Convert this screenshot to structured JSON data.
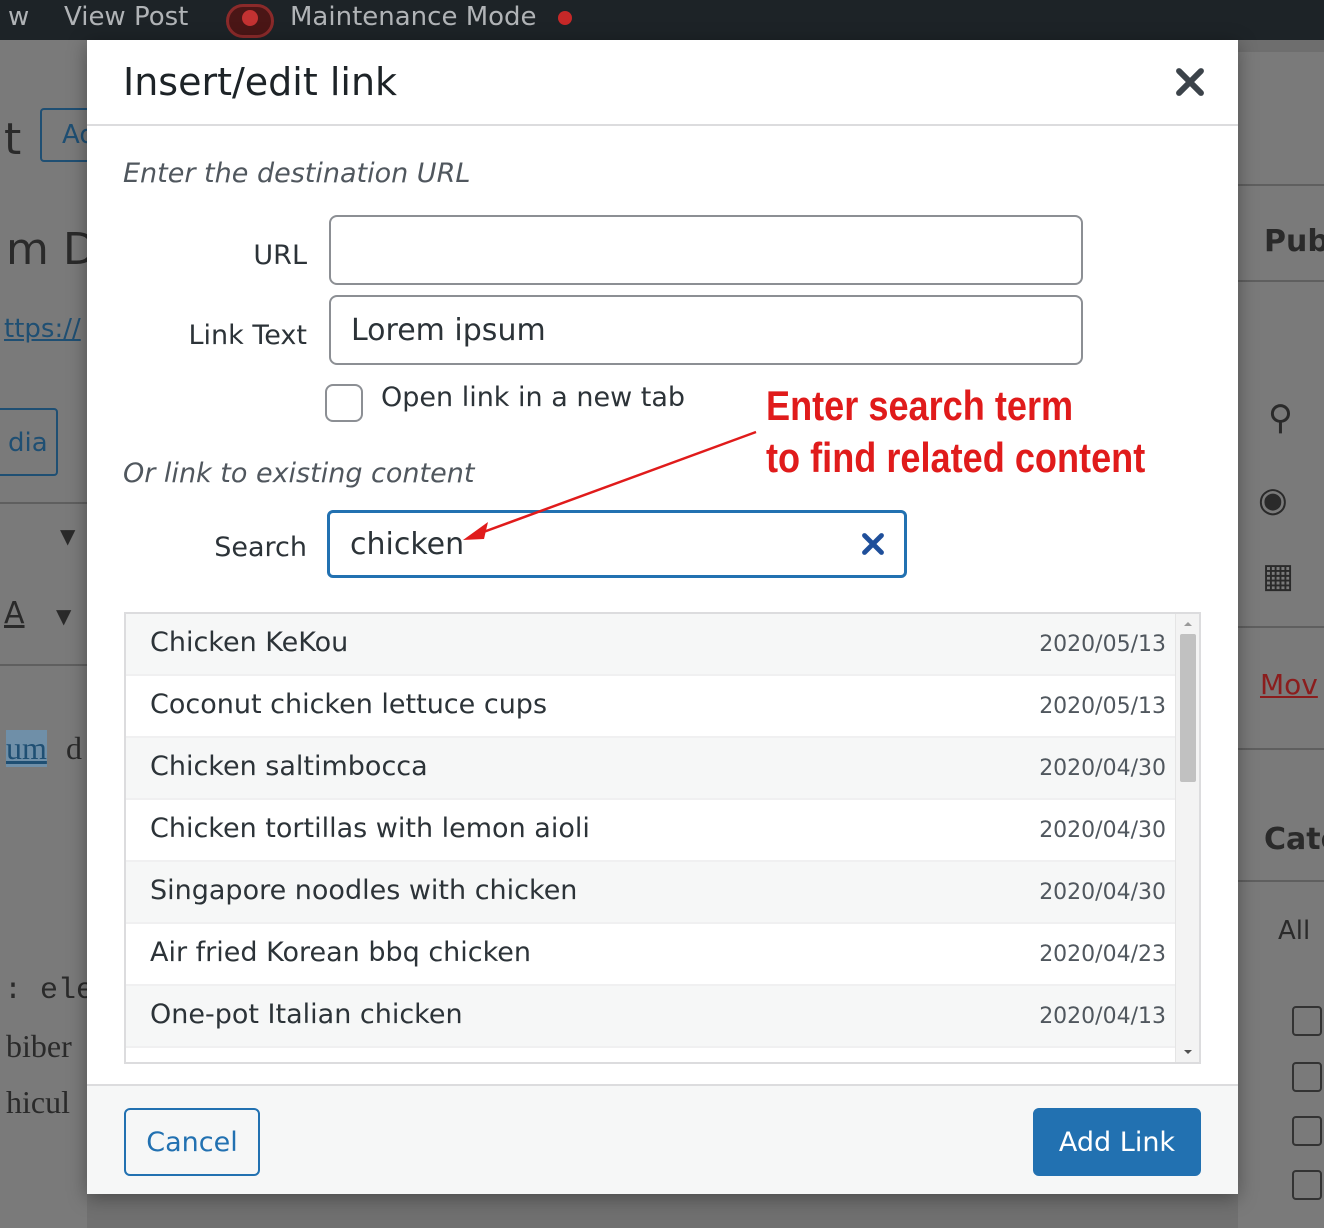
{
  "background": {
    "admin_bar": {
      "left_partial": "w",
      "view_post": "View Post",
      "maintenance_mode": "Maintenance Mode"
    },
    "left_fragments": {
      "title_char": "t",
      "add_btn": "Ad",
      "heading": "m D",
      "permalink": "ttps://",
      "media_btn": "dia",
      "text_a": "A",
      "link_word": "um",
      "link_word_tail": "d",
      "code_line": ": ele",
      "body_line_1": "biber",
      "body_line_2": "hicul"
    },
    "right_fragments": {
      "publish": "Pub",
      "move": "Mov",
      "categories": "Cate",
      "all": "All"
    }
  },
  "modal": {
    "title": "Insert/edit link",
    "destination_label": "Enter the destination URL",
    "url_label": "URL",
    "url_value": "",
    "link_text_label": "Link Text",
    "link_text_value": "Lorem ipsum",
    "new_tab_label": "Open link in a new tab",
    "new_tab_checked": false,
    "existing_label": "Or link to existing content",
    "search_label": "Search",
    "search_value": "chicken",
    "results": [
      {
        "title": "Chicken KeKou",
        "date": "2020/05/13"
      },
      {
        "title": "Coconut chicken lettuce cups",
        "date": "2020/05/13"
      },
      {
        "title": "Chicken saltimbocca",
        "date": "2020/04/30"
      },
      {
        "title": "Chicken tortillas with lemon aioli",
        "date": "2020/04/30"
      },
      {
        "title": "Singapore noodles with chicken",
        "date": "2020/04/30"
      },
      {
        "title": "Air fried Korean bbq chicken",
        "date": "2020/04/23"
      },
      {
        "title": "One-pot Italian chicken",
        "date": "2020/04/13"
      }
    ],
    "cancel_label": "Cancel",
    "add_link_label": "Add Link"
  },
  "annotation": {
    "line1": "Enter search term",
    "line2": "to find related content",
    "color": "#e01b1b"
  },
  "colors": {
    "accent": "#2271b1",
    "close_icon": "#3c434a"
  },
  "icons": {
    "close": "close-icon",
    "search_clear": "clear-search-icon",
    "scroll_up": "scroll-up-icon",
    "scroll_down": "scroll-down-icon"
  }
}
